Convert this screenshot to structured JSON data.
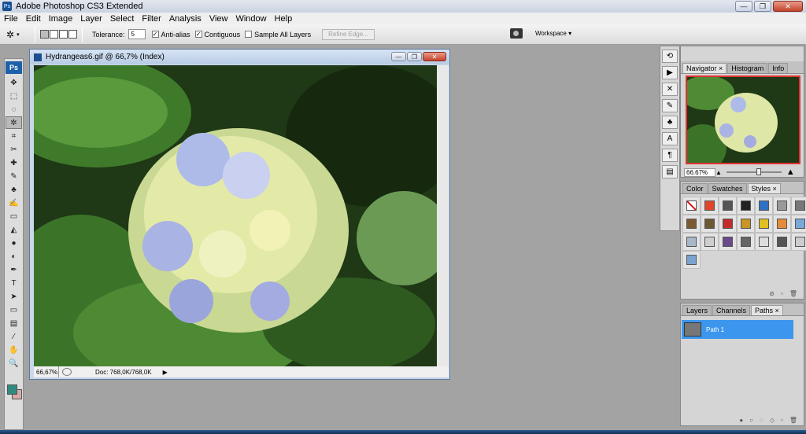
{
  "window": {
    "title": "Adobe Photoshop CS3 Extended",
    "minimize": "—",
    "maximize": "❐",
    "close": "✕"
  },
  "menu": [
    "File",
    "Edit",
    "Image",
    "Layer",
    "Select",
    "Filter",
    "Analysis",
    "View",
    "Window",
    "Help"
  ],
  "options": {
    "tolerance_label": "Tolerance:",
    "tolerance_value": "5",
    "antialias_label": "Anti-alias",
    "contiguous_label": "Contiguous",
    "sample_all_label": "Sample All Layers",
    "refine_edge_label": "Refine Edge...",
    "workspace_label": "Workspace ▾"
  },
  "toolbox": {
    "logo": "Ps",
    "tools": [
      "move-icon",
      "marquee-icon",
      "lasso-icon",
      "magic-wand-icon",
      "crop-icon",
      "slice-icon",
      "healing-icon",
      "brush-icon",
      "stamp-icon",
      "history-brush-icon",
      "eraser-icon",
      "paint-bucket-icon",
      "blur-icon",
      "dodge-icon",
      "pen-icon",
      "type-icon",
      "path-select-icon",
      "shape-icon",
      "notes-icon",
      "eyedropper-icon",
      "hand-icon",
      "zoom-icon"
    ],
    "glyphs": [
      "✥",
      "⬚",
      "◌",
      "✲",
      "⌗",
      "✂",
      "✚",
      "✎",
      "♣",
      "✍",
      "▭",
      "◭",
      "●",
      "◐",
      "✒",
      "T",
      "➤",
      "▭",
      "▤",
      "⁄",
      "✋",
      "🔍"
    ],
    "fg_color": "#2f8b80",
    "bg_color": "#d7a9a8"
  },
  "document": {
    "title": "Hydrangeas6.gif @ 66,7% (Index)",
    "zoom": "66,67%",
    "doc_info": "Doc: 768,0K/768,0K"
  },
  "navigator": {
    "tabs": [
      "Navigator ×",
      "Histogram",
      "Info"
    ],
    "zoom": "66.67%"
  },
  "styles_panel": {
    "tabs": [
      "Color",
      "Swatches",
      "Styles ×"
    ],
    "swatches": [
      "#ffffff",
      "#e0462c",
      "#555555",
      "#222222",
      "#2f6fc4",
      "#999999",
      "#777777",
      "#7a5a32",
      "#6d5a35",
      "#c22b2b",
      "#c89526",
      "#e2c021",
      "#e58b3c",
      "#78a9d8",
      "#a8b8c8",
      "#cfcfcf",
      "#6a4a8a",
      "#666666",
      "#dddddd",
      "#555555",
      "#cccccc",
      "#7ba3cf"
    ]
  },
  "layers_panel": {
    "tabs": [
      "Layers",
      "Channels",
      "Paths ×"
    ],
    "path_name": "Path 1"
  }
}
